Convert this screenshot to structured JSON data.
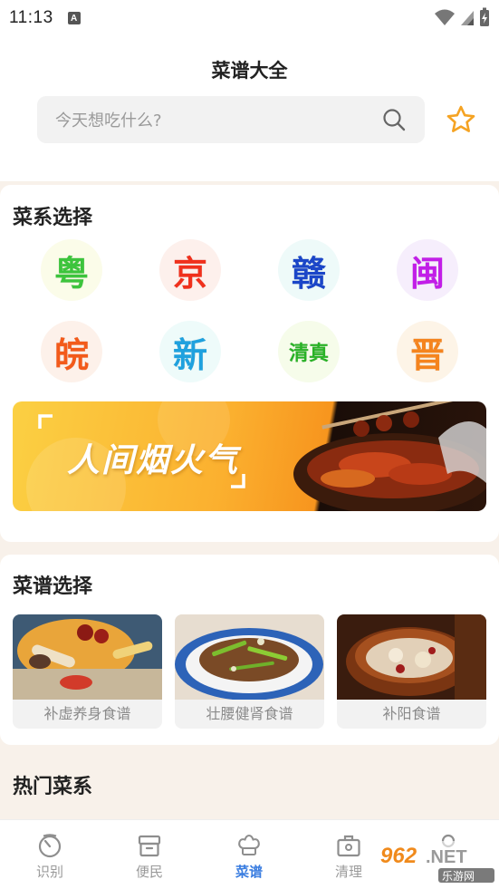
{
  "status_bar": {
    "time": "11:13",
    "app_icon_letter": "A"
  },
  "header": {
    "title": "菜谱大全"
  },
  "search": {
    "placeholder": "今天想吃什么?"
  },
  "cuisine_section": {
    "title": "菜系选择",
    "items": [
      {
        "label": "粤",
        "color": "#3cc43c",
        "bg": "#fbfce9"
      },
      {
        "label": "京",
        "color": "#f0301c",
        "bg": "#fdf0ec"
      },
      {
        "label": "赣",
        "color": "#1b46c8",
        "bg": "#eefaf9"
      },
      {
        "label": "闽",
        "color": "#c21ee8",
        "bg": "#f6eefc"
      },
      {
        "label": "皖",
        "color": "#f35a1a",
        "bg": "#fdf1ea"
      },
      {
        "label": "新",
        "color": "#1fa1de",
        "bg": "#eefbfa"
      },
      {
        "label": "清真",
        "color": "#29b226",
        "bg": "#f6fcea"
      },
      {
        "label": "晋",
        "color": "#f5841e",
        "bg": "#fdf4e7"
      }
    ],
    "banner_text": "人间烟火气"
  },
  "recipe_section": {
    "title": "菜谱选择",
    "items": [
      {
        "label": "补虚养身食谱"
      },
      {
        "label": "壮腰健肾食谱"
      },
      {
        "label": "补阳食谱"
      }
    ]
  },
  "hot_section": {
    "title": "热门菜系"
  },
  "tabs": [
    {
      "label": "识别",
      "icon": "timer-icon",
      "active": false
    },
    {
      "label": "便民",
      "icon": "box-icon",
      "active": false
    },
    {
      "label": "菜谱",
      "icon": "chef-hat-icon",
      "active": true
    },
    {
      "label": "清理",
      "icon": "briefcase-icon",
      "active": false
    },
    {
      "label": "",
      "icon": "user-icon",
      "active": false
    }
  ],
  "watermark": {
    "text_top": "962.NET",
    "text_bottom": "乐游网"
  },
  "colors": {
    "accent": "#3a7de0",
    "star": "#f5a323"
  }
}
